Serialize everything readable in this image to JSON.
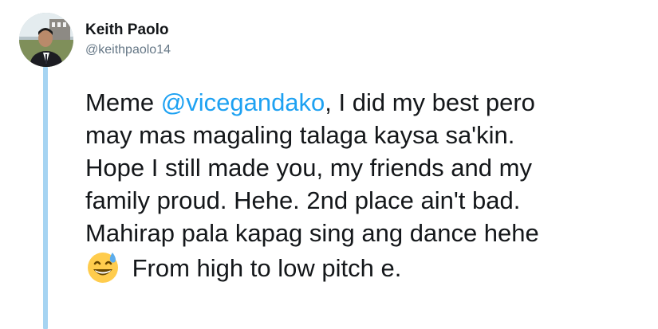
{
  "author": {
    "display_name": "Keith Paolo",
    "handle": "@keithpaolo14",
    "avatar_icon": "profile-photo"
  },
  "tweet": {
    "line1_prefix": "Meme ",
    "mention": "@vicegandako",
    "line1_suffix": ", I did my best pero",
    "line2": "may mas magaling talaga kaysa sa'kin.",
    "line3": "Hope I still made you, my friends and my",
    "line4": "family proud. Hehe. 2nd place ain't bad.",
    "line5": "Mahirap pala kapag sing ang dance hehe",
    "emoji": "grinning-face-with-sweat",
    "line6": " From high to low pitch e."
  },
  "colors": {
    "mention": "#1da1f2",
    "thread_line": "#a6d4f2",
    "handle": "#657786",
    "text": "#14171a"
  }
}
